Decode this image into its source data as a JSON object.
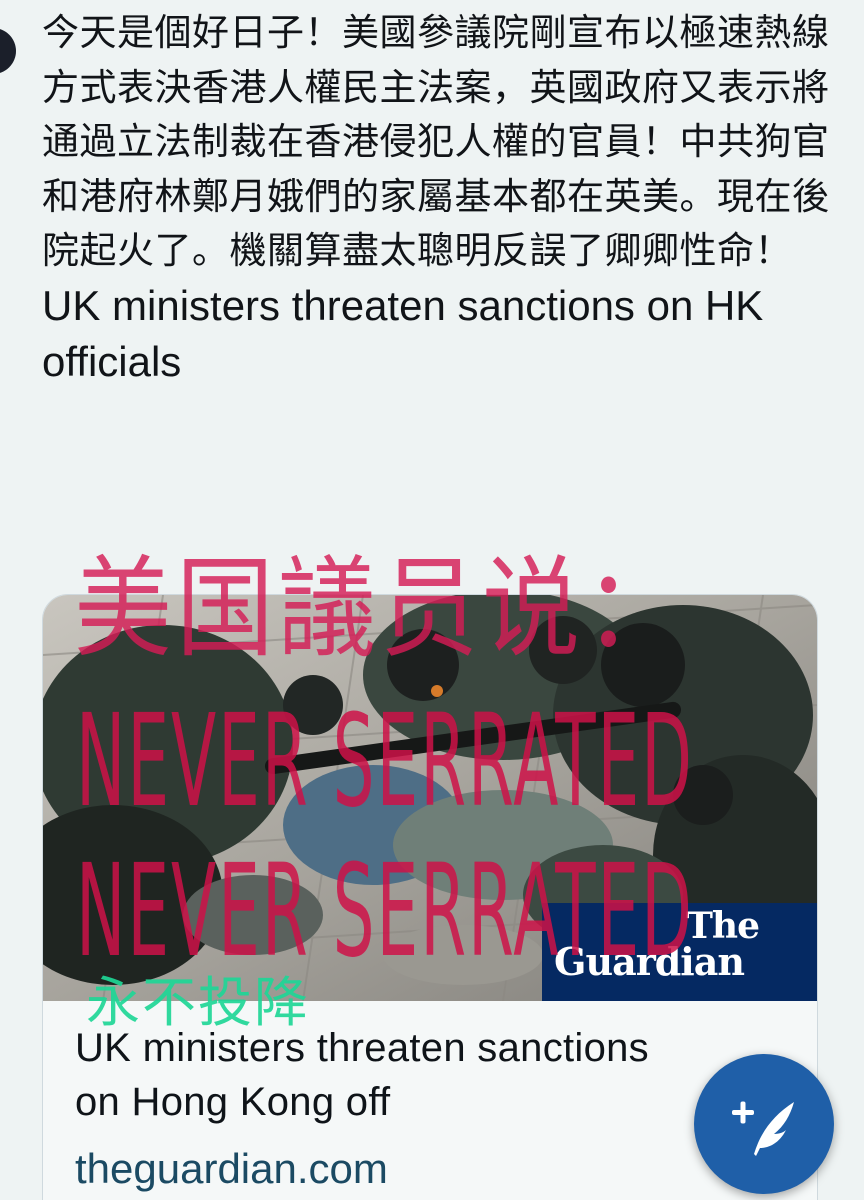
{
  "tweet": {
    "text_cn": "今天是個好日子！美國參議院剛宣布以極速熱線方式表決香港人權民主法案，英國政府又表示將通過立法制裁在香港侵犯人權的官員！中共狗官和港府林鄭月娥們的家屬基本都在英美。現在後院起火了。機關算盡太聰明反誤了卿卿性命！",
    "text_en": "UK ministers threaten sanctions on HK officials"
  },
  "card": {
    "title": "UK ministers threaten sanctions on Hong Kong off",
    "domain": "theguardian.com",
    "badge_the": "The",
    "badge_name": "Guardian"
  },
  "overlay": {
    "headline_cn": "美国議员说：",
    "line1": "NEVER SERRATED",
    "line2": "NEVER SERRATED",
    "slogan": "永不投降"
  },
  "fab": {
    "icon": "compose-feather-icon"
  },
  "colors": {
    "background": "#eef3f3",
    "overlay_red": "#d41c56",
    "overlay_green": "#1ed696",
    "guardian_blue": "#052962",
    "fab_blue": "#1f5fa8"
  }
}
